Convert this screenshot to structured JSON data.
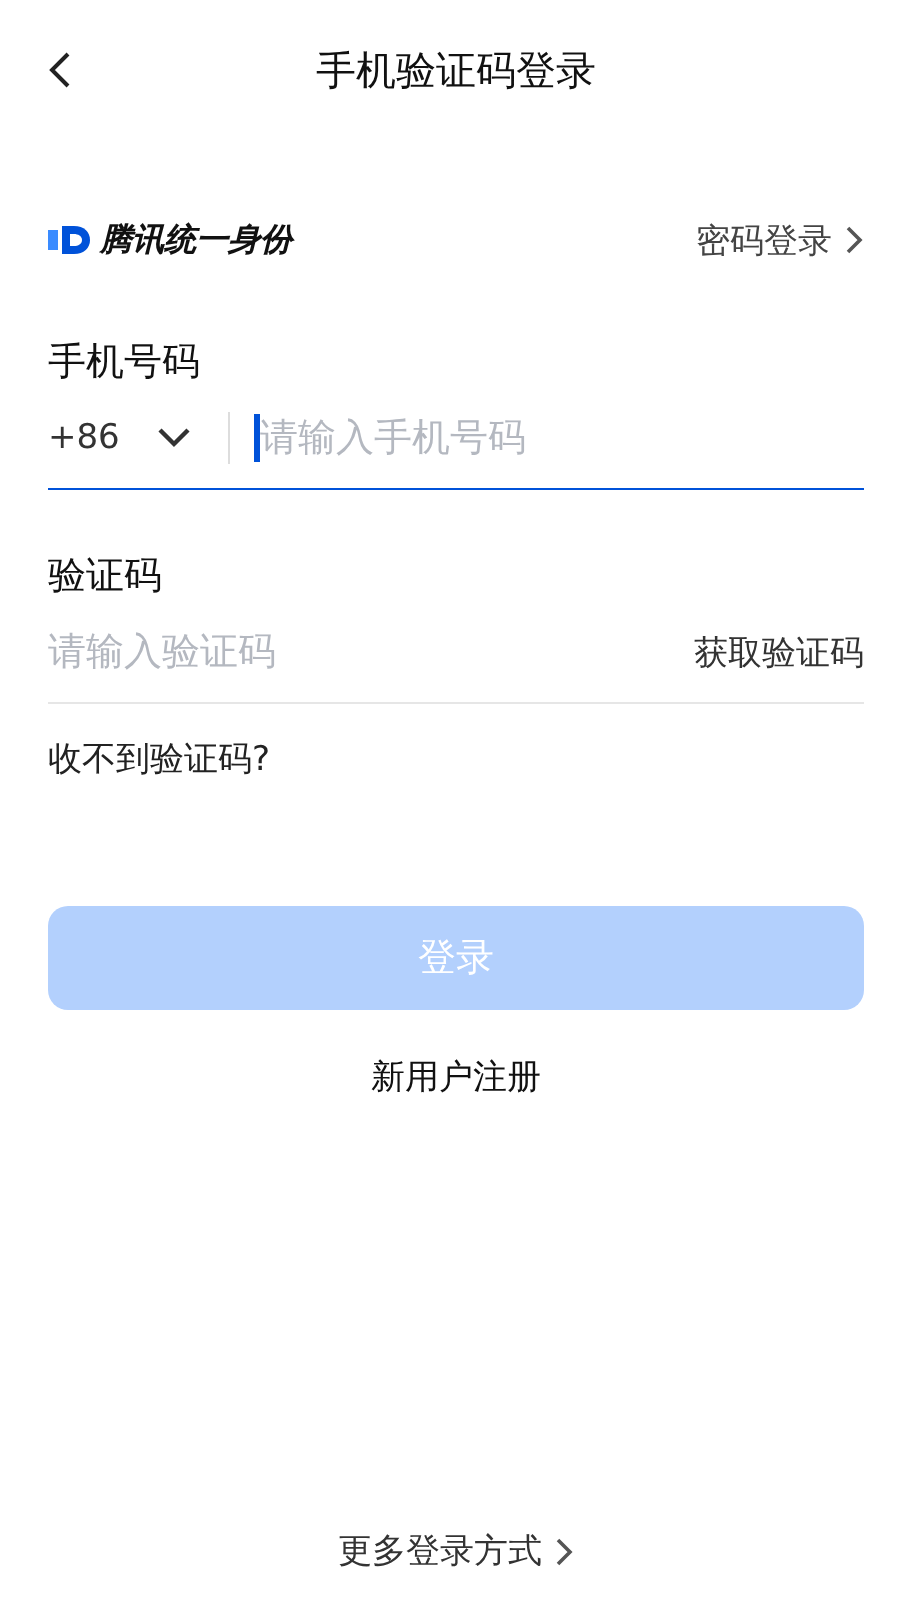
{
  "header": {
    "title": "手机验证码登录"
  },
  "brand": {
    "name": "腾讯统一身份",
    "switch_link": "密码登录"
  },
  "phone": {
    "label": "手机号码",
    "country_code": "+86",
    "placeholder": "请输入手机号码",
    "focused": true
  },
  "code": {
    "label": "验证码",
    "placeholder": "请输入验证码",
    "get_code": "获取验证码",
    "focused": false
  },
  "help_link": "收不到验证码?",
  "login_button": {
    "label": "登录",
    "disabled": true
  },
  "register_link": "新用户注册",
  "more_link": "更多登录方式"
}
